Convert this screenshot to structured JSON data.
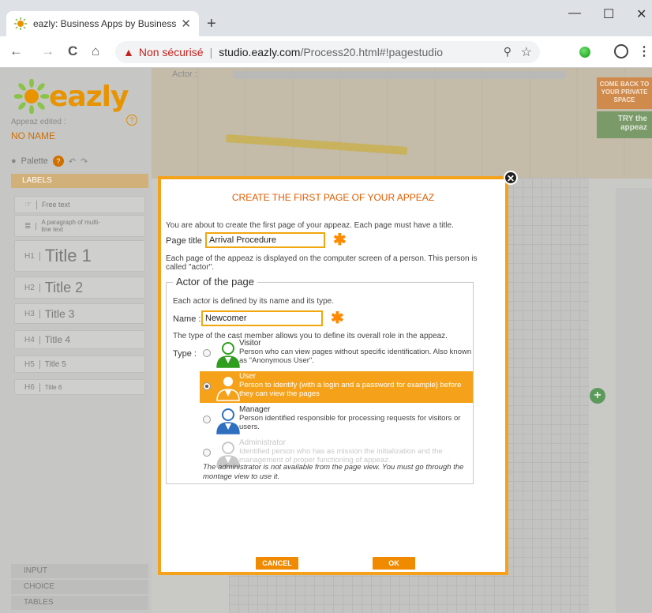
{
  "browser": {
    "tab_title": "eazly: Business Apps by Business",
    "tab_close": "✕",
    "new_tab": "+",
    "win_minimize": "—",
    "win_maximize": "☐",
    "win_close": "✕",
    "back": "←",
    "forward": "→",
    "reload": "C",
    "home": "⌂",
    "url_insecure": "Non sécurisé",
    "url_host": "studio.eazly.com",
    "url_path": "/Process20.html#!pagestudio",
    "colors": {
      "tabbar": "#dee1e6",
      "warning": "#c5221f"
    }
  },
  "sidebar": {
    "logo_text": "eazly",
    "appeaz_label": "Appeaz edited :",
    "appeaz_name": "NO NAME",
    "palette_label": "Palette",
    "section": "LABELS",
    "items": [
      {
        "icon": "free-text-icon",
        "label": "Free text"
      },
      {
        "icon": "paragraph-icon",
        "label": "A paragraph of multi-line text"
      },
      {
        "icon": "h1-icon",
        "label": "Title 1"
      },
      {
        "icon": "h2-icon",
        "label": "Title 2"
      },
      {
        "icon": "h3-icon",
        "label": "Title 3"
      },
      {
        "icon": "h4-icon",
        "label": "Title 4"
      },
      {
        "icon": "h5-icon",
        "label": "Title 5"
      },
      {
        "icon": "h6-icon",
        "label": "Title 6"
      }
    ],
    "item_icons": [
      "☞",
      "≣",
      "H1",
      "H2",
      "H3",
      "H4",
      "H5",
      "H6"
    ],
    "bottom_sections": [
      "INPUT",
      "CHOICE",
      "TABLES"
    ]
  },
  "stage": {
    "actor_label": "Actor :",
    "back_button": "COME BACK TO YOUR PRIVATE SPACE",
    "try_button": "TRY the appeaz",
    "add": "+"
  },
  "modal": {
    "title": "CREATE THE FIRST PAGE OF YOUR APPEAZ",
    "intro": "You are about to create the first page of your appeaz. Each page must have a title.",
    "page_title_label": "Page title :",
    "page_title_value": "Arrival Procedure",
    "actor_info": "Each page of the appeaz is displayed on the computer screen of a person. This person is called \"actor\".",
    "actor_legend": "Actor of the page",
    "actor_def": "Each actor is defined by its name and its type.",
    "name_label": "Name :",
    "name_value": "Newcomer",
    "type_info": "The type of the cast member allows you to define its overall role in the appeaz.",
    "type_label": "Type :",
    "required_mark": "✱",
    "options": [
      {
        "title": "Visitor",
        "desc": "Person who can view pages without specific identification. Also known as \"Anonymous User\".",
        "color": "#2f9e1e",
        "selected": false,
        "disabled": false
      },
      {
        "title": "User",
        "desc": "Person to identify (with a login and a password for example) before they can view the pages",
        "color": "#f5a21a",
        "selected": true,
        "disabled": false
      },
      {
        "title": "Manager",
        "desc": "Person identified responsible for processing requests for visitors or users.",
        "color": "#2e6fc0",
        "selected": false,
        "disabled": false
      },
      {
        "title": "Administrator",
        "desc": "Identified person who has as mission the initialization and the management of proper functioning of appeaz.",
        "color": "#c8c8c8",
        "selected": false,
        "disabled": true
      }
    ],
    "note": "The administrator is not available from the page view. You must go through the montage view to use it.",
    "cancel": "CANCEL",
    "ok": "OK"
  }
}
